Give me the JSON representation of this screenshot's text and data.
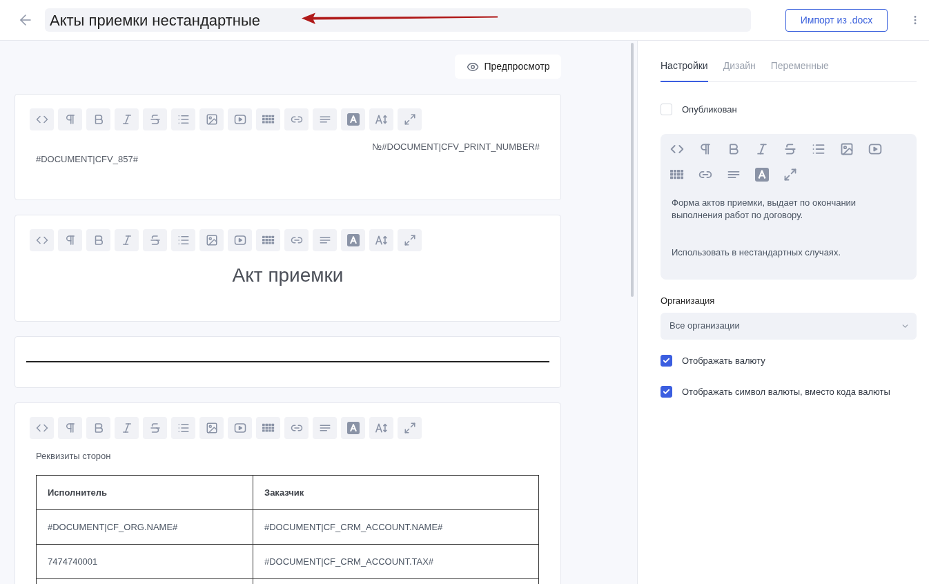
{
  "header": {
    "title": "Акты приемки нестандартные",
    "import_button": "Импорт из .docx"
  },
  "editor": {
    "preview_button": "Предпросмотр",
    "blocks": [
      {
        "kind": "text",
        "lines": [
          "№#DOCUMENT|CFV_PRINT_NUMBER#",
          "#DOCUMENT|CFV_857#"
        ]
      },
      {
        "kind": "heading",
        "text": "Акт приемки"
      },
      {
        "kind": "rule"
      },
      {
        "kind": "table",
        "caption": "Реквизиты сторон",
        "columns": [
          "Исполнитель",
          "Заказчик"
        ],
        "rows": [
          [
            "#DOCUMENT|CF_ORG.NAME#",
            "#DOCUMENT|CF_CRM_ACCOUNT.NAME#"
          ],
          [
            "7474740001",
            "#DOCUMENT|CF_CRM_ACCOUNT.TAX#"
          ]
        ]
      }
    ]
  },
  "settings": {
    "tabs": [
      {
        "label": "Настройки",
        "selected": true
      },
      {
        "label": "Дизайн",
        "selected": false
      },
      {
        "label": "Переменные",
        "selected": false
      }
    ],
    "published": {
      "label": "Опубликован",
      "checked": false
    },
    "description": {
      "paragraphs": [
        "Форма актов приемки, выдает по окончании выполнения работ по договору.",
        "Использовать в нестандартных случаях."
      ]
    },
    "organization": {
      "label": "Организация",
      "value": "Все организации"
    },
    "options": [
      {
        "label": "Отображать валюту",
        "checked": true
      },
      {
        "label": "Отображать символ валюты, вместо кода валюты",
        "checked": true
      }
    ]
  }
}
